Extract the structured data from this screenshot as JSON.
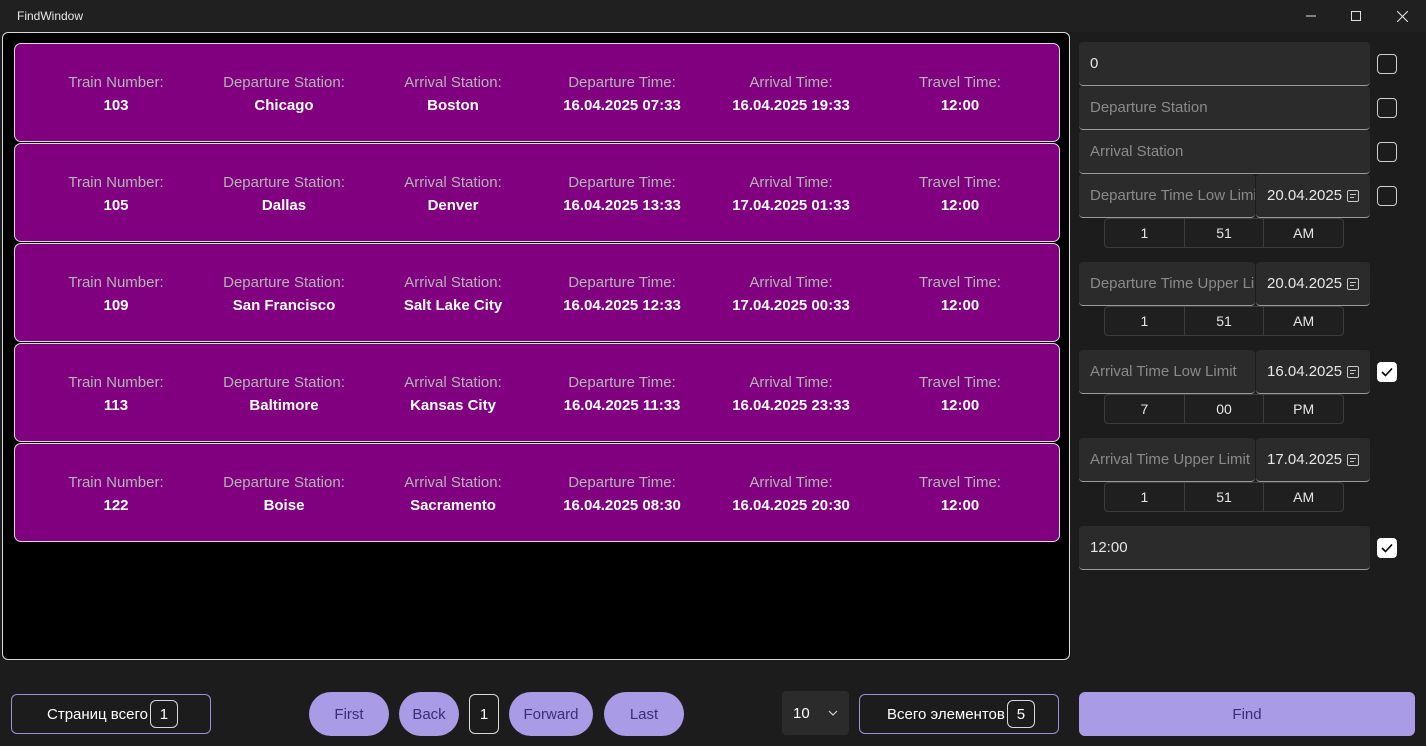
{
  "window": {
    "title": "FindWindow"
  },
  "labels": {
    "train_number": "Train Number:",
    "departure_station": "Departure Station:",
    "arrival_station": "Arrival Station:",
    "departure_time": "Departure Time:",
    "arrival_time": "Arrival Time:",
    "travel_time": "Travel Time:"
  },
  "trains": [
    {
      "number": "103",
      "dep_station": "Chicago",
      "arr_station": "Boston",
      "dep_time": "16.04.2025 07:33",
      "arr_time": "16.04.2025 19:33",
      "travel": "12:00"
    },
    {
      "number": "105",
      "dep_station": "Dallas",
      "arr_station": "Denver",
      "dep_time": "16.04.2025 13:33",
      "arr_time": "17.04.2025 01:33",
      "travel": "12:00"
    },
    {
      "number": "109",
      "dep_station": "San Francisco",
      "arr_station": "Salt Lake City",
      "dep_time": "16.04.2025 12:33",
      "arr_time": "17.04.2025 00:33",
      "travel": "12:00"
    },
    {
      "number": "113",
      "dep_station": "Baltimore",
      "arr_station": "Kansas City",
      "dep_time": "16.04.2025 11:33",
      "arr_time": "16.04.2025 23:33",
      "travel": "12:00"
    },
    {
      "number": "122",
      "dep_station": "Boise",
      "arr_station": "Sacramento",
      "dep_time": "16.04.2025 08:30",
      "arr_time": "16.04.2025 20:30",
      "travel": "12:00"
    }
  ],
  "filters": {
    "train_number": {
      "value": "0",
      "checked": false
    },
    "departure_station": {
      "placeholder": "Departure Station",
      "checked": false
    },
    "arrival_station": {
      "placeholder": "Arrival Station",
      "checked": false
    },
    "dep_low": {
      "placeholder": "Departure Time Low Limit",
      "date": "20.04.2025",
      "hour": "1",
      "minute": "51",
      "period": "AM",
      "checked": false
    },
    "dep_high": {
      "placeholder": "Departure Time Upper Limit",
      "date": "20.04.2025",
      "hour": "1",
      "minute": "51",
      "period": "AM"
    },
    "arr_low": {
      "placeholder": "Arrival Time Low Limit",
      "date": "16.04.2025",
      "hour": "7",
      "minute": "00",
      "period": "PM",
      "checked": true
    },
    "arr_high": {
      "placeholder": "Arrival Time Upper Limit",
      "date": "17.04.2025",
      "hour": "1",
      "minute": "51",
      "period": "AM"
    },
    "travel_time": {
      "value": "12:00",
      "checked": true
    }
  },
  "pagination": {
    "pages_total_label": "Страниц всего",
    "pages_total": "1",
    "first": "First",
    "back": "Back",
    "current_page": "1",
    "forward": "Forward",
    "last": "Last",
    "page_size": "10",
    "items_total_label": "Всего элементов",
    "items_total": "5"
  },
  "find_button": "Find",
  "colors": {
    "card": "#800080",
    "accent": "#a99be6",
    "accent_text": "#3b2d7a"
  }
}
